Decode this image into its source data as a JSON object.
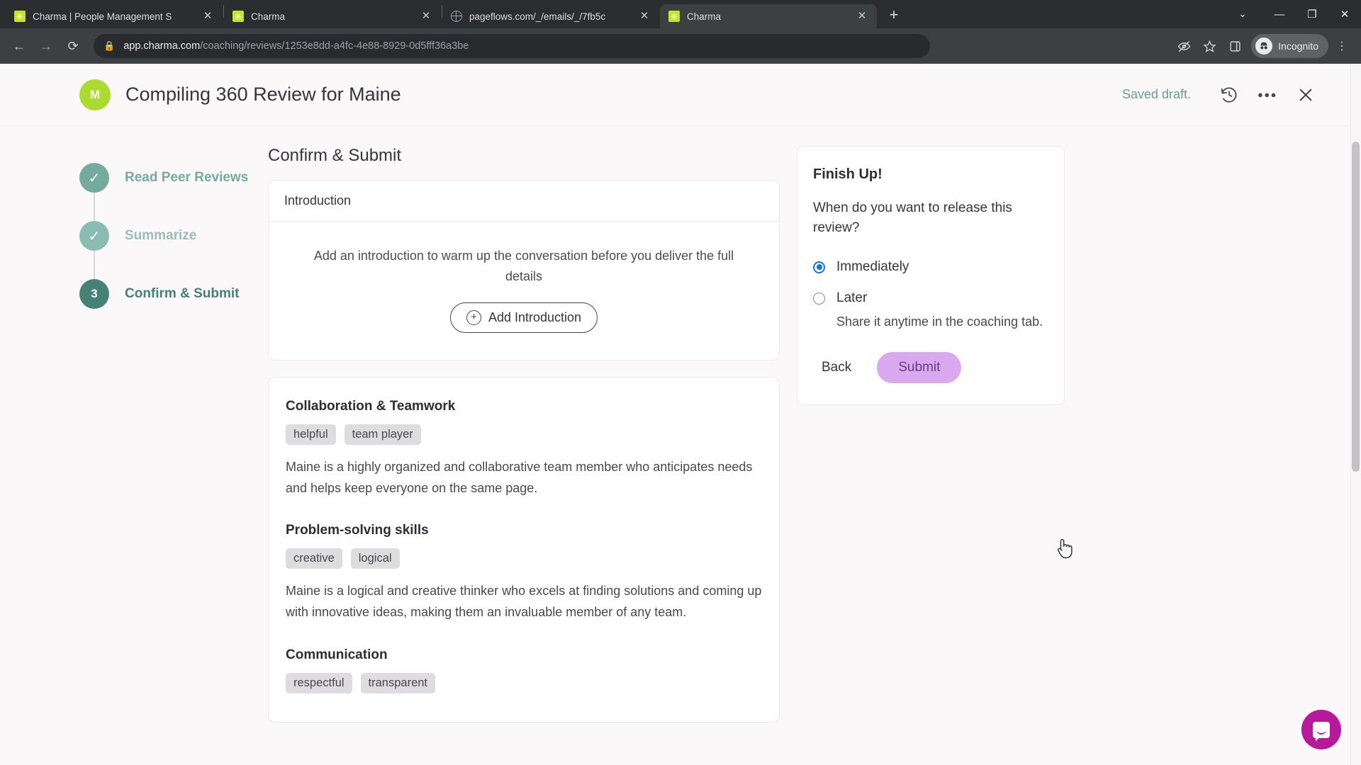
{
  "browser": {
    "tabs": [
      {
        "title": "Charma | People Management S",
        "favicon": "charma-icon",
        "active": false
      },
      {
        "title": "Charma",
        "favicon": "charma-icon",
        "active": false
      },
      {
        "title": "pageflows.com/_/emails/_/7fb5c",
        "favicon": "globe-icon",
        "active": false
      },
      {
        "title": "Charma",
        "favicon": "charma-icon",
        "active": true
      }
    ],
    "new_tab_label": "+",
    "tab_close_label": "✕",
    "tab_search_label": "⌄",
    "window_controls": {
      "minimize": "—",
      "maximize": "❐",
      "close": "✕"
    },
    "nav": {
      "back": "←",
      "forward": "→",
      "reload": "⟳"
    },
    "omnibox": {
      "lock_icon": "lock-icon",
      "url_domain": "app.charma.com",
      "url_path": "/coaching/reviews/1253e8dd-a4fc-4e88-8929-0d5fff36a3be"
    },
    "toolbar_right": {
      "tracking_icon": "eye-crossed-icon",
      "bookmark_icon": "star-icon",
      "sidepanel_icon": "side-panel-icon",
      "profile_label": "Incognito",
      "profile_icon": "incognito-hat-icon",
      "menu_icon": "kebab-menu-icon"
    }
  },
  "header": {
    "avatar_initial": "M",
    "avatar_color": "#aadb2e",
    "title": "Compiling 360 Review for Maine",
    "saved_status": "Saved draft.",
    "history_icon": "history-revert-icon",
    "more_icon": "more-options-icon",
    "close_icon": "close-icon"
  },
  "stepper": {
    "steps": [
      {
        "label": "Read Peer Reviews",
        "state": "complete",
        "marker": "✓",
        "circle_color": "#74ab9f",
        "label_color": "#74ab9f"
      },
      {
        "label": "Summarize",
        "state": "complete",
        "marker": "✓",
        "circle_color": "#8bbcb2",
        "label_color": "#9bbdb6"
      },
      {
        "label": "Confirm & Submit",
        "state": "current",
        "marker": "3",
        "circle_color": "#468176",
        "label_color": "#468176"
      }
    ]
  },
  "main": {
    "section_title": "Confirm & Submit",
    "introduction_card": {
      "heading": "Introduction",
      "hint": "Add an introduction to warm up the conversation before you deliver the full details",
      "add_button": "Add Introduction",
      "add_icon": "plus-circle-icon"
    },
    "feedback": [
      {
        "title": "Collaboration & Teamwork",
        "tags": [
          "helpful",
          "team player"
        ],
        "text": "Maine is a highly organized and collaborative team member who anticipates needs and helps keep everyone on the same page."
      },
      {
        "title": "Problem-solving skills",
        "tags": [
          "creative",
          "logical"
        ],
        "text": "Maine is a logical and creative thinker who excels at finding solutions and coming up with innovative ideas, making them an invaluable member of any team."
      },
      {
        "title": "Communication",
        "tags": [
          "respectful",
          "transparent"
        ],
        "text": ""
      }
    ]
  },
  "finish_panel": {
    "title": "Finish Up!",
    "question": "When do you want to release this review?",
    "options": [
      {
        "label": "Immediately",
        "selected": true,
        "sub": ""
      },
      {
        "label": "Later",
        "selected": false,
        "sub": "Share it anytime in the coaching tab."
      }
    ],
    "back_label": "Back",
    "submit_label": "Submit",
    "submit_color": "#d9a8ef",
    "radio_accent": "#1473e6"
  },
  "widgets": {
    "intercom_label": "intercom-messenger-icon",
    "intercom_color": "#b7199b"
  }
}
